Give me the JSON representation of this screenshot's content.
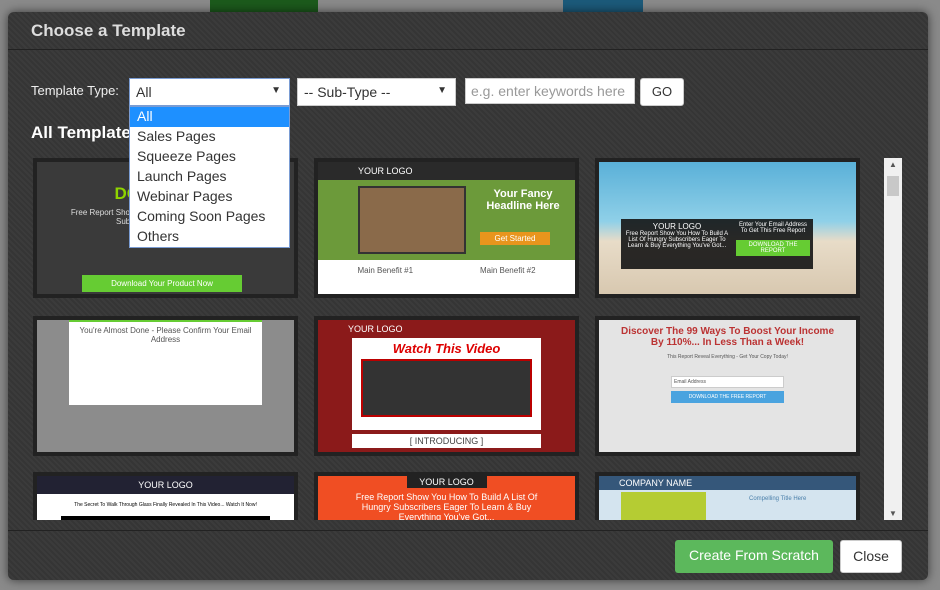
{
  "dialog": {
    "title": "Choose a Template",
    "close_label": "Close",
    "create_label": "Create From Scratch"
  },
  "filters": {
    "type_label": "Template Type:",
    "type_value": "All",
    "subtype_value": "-- Sub-Type --",
    "keywords_placeholder": "e.g. enter keywords here",
    "go_label": "GO",
    "type_options": [
      "All",
      "Sales Pages",
      "Squeeze Pages",
      "Launch Pages",
      "Webinar Pages",
      "Coming Soon Pages",
      "Others"
    ]
  },
  "section_title": "All Templates",
  "templates": [
    {
      "headline": "DOWNLOAD",
      "sub": "Free Report Show You How To Build A List Of Hungry Subscribers Eager To Learn",
      "cta": "Download Your Product Now"
    },
    {
      "logo": "YOUR LOGO",
      "headline": "Your Fancy Headline Here",
      "cta": "Get Started",
      "b1": "Main Benefit #1",
      "b2": "Main Benefit #2"
    },
    {
      "logo": "YOUR LOGO",
      "headline": "Free Report Show You How To Build A List Of Hungry Subscribers Eager To Learn & Buy Everything You've Got...",
      "side": "Enter Your Email Address To Get This Free Report",
      "cta": "DOWNLOAD THE REPORT"
    },
    {
      "headline": "You're Almost Done - Please Confirm Your Email Address"
    },
    {
      "logo": "YOUR LOGO",
      "headline": "Watch This Video",
      "sub": "[ INTRODUCING ]"
    },
    {
      "headline": "Discover The 99 Ways To Boost Your Income By 110%... In Less Than a Week!",
      "sub": "This Report Reveal Everything - Get Your Copy Today!",
      "field": "Email Address",
      "cta": "DOWNLOAD THE FREE REPORT"
    },
    {
      "logo": "YOUR LOGO",
      "headline": "The Secret To Walk Through Glass Finally Revealed In This Video... Watch It Now!"
    },
    {
      "logo": "YOUR LOGO",
      "headline": "Free Report Show You How To Build A List Of Hungry Subscribers Eager To Learn & Buy Everything You've Got..."
    },
    {
      "logo": "COMPANY NAME",
      "headline": "Compelling Title Here"
    }
  ],
  "colors": {
    "create": "#5cb85c",
    "accent": "#1e90ff"
  }
}
